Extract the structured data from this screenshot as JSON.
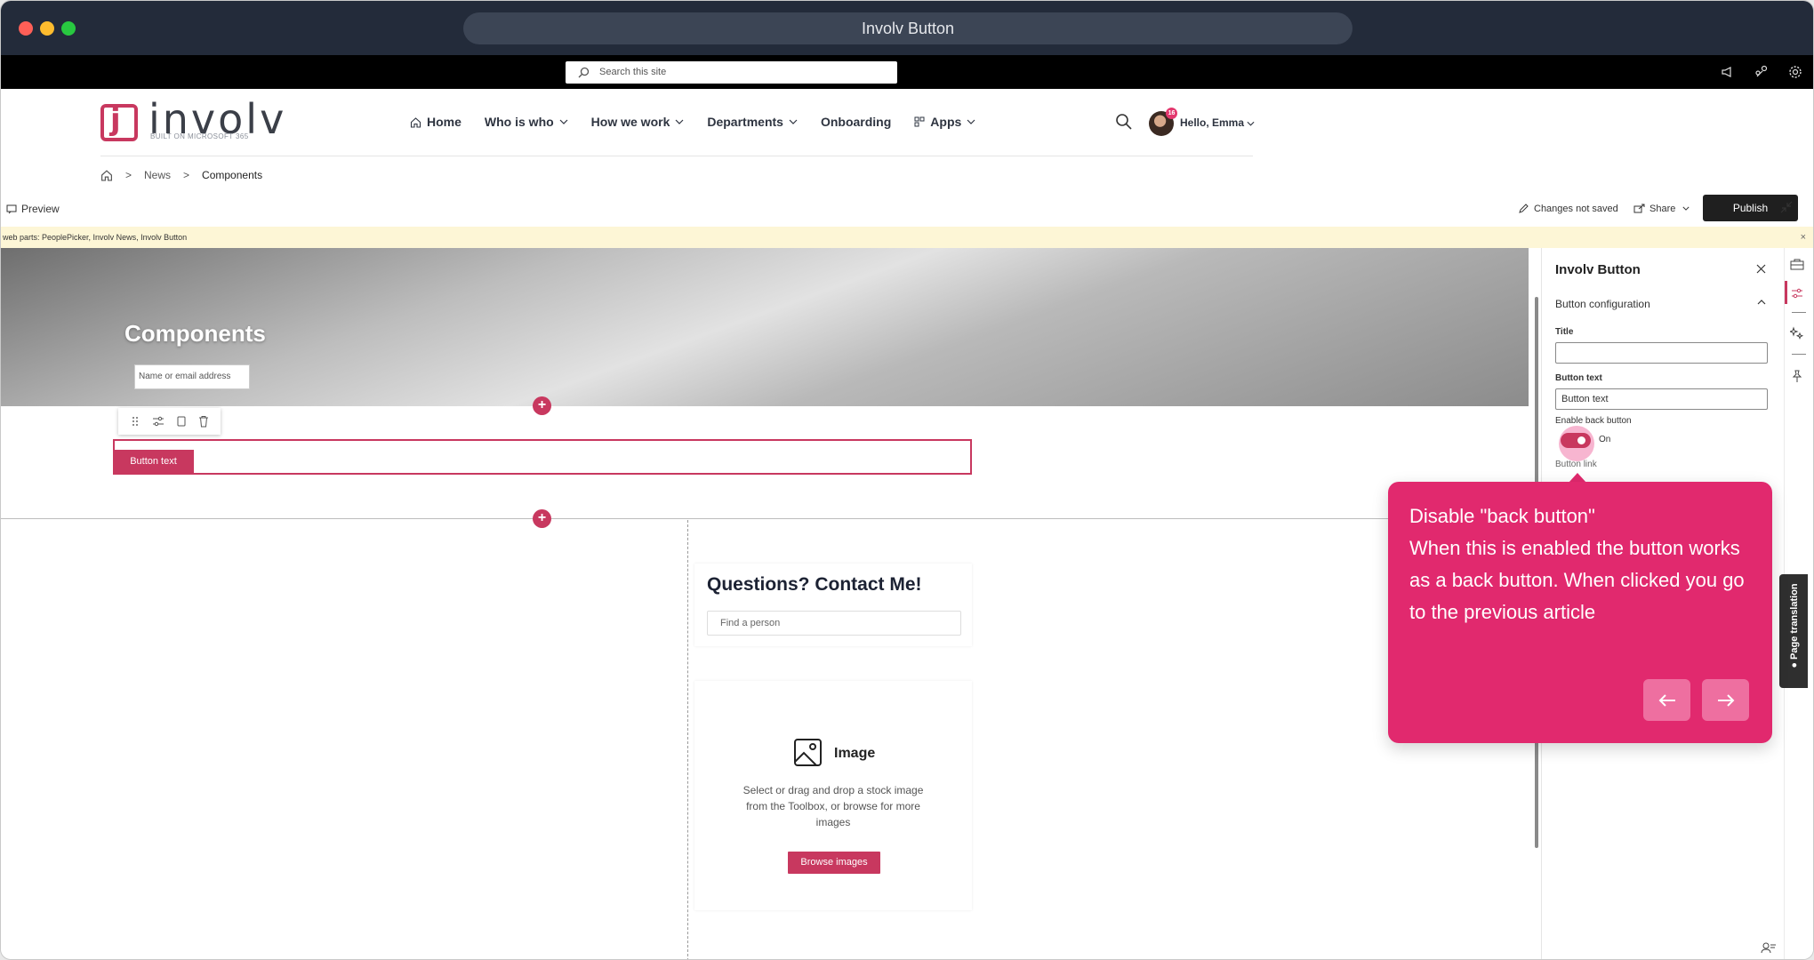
{
  "window": {
    "title": "Involv Button"
  },
  "suitebar": {
    "search_placeholder": "Search this site"
  },
  "brand": {
    "name": "involv",
    "tagline": "BUILT ON MICROSOFT 365",
    "accent": "#c8385f"
  },
  "nav": {
    "items": [
      {
        "label": "Home"
      },
      {
        "label": "Who is who"
      },
      {
        "label": "How we work"
      },
      {
        "label": "Departments"
      },
      {
        "label": "Onboarding"
      },
      {
        "label": "Apps"
      }
    ]
  },
  "user": {
    "greeting": "Hello, Emma",
    "badge": "16"
  },
  "breadcrumb": {
    "sep": ">",
    "items": [
      "News",
      "Components"
    ]
  },
  "editbar": {
    "preview": "Preview",
    "status": "Changes not saved",
    "share": "Share",
    "publish": "Publish"
  },
  "warning": {
    "text": "web parts: PeoplePicker, Involv News, Involv Button",
    "close": "×"
  },
  "hero": {
    "title": "Components",
    "people_placeholder": "Name or email address"
  },
  "button_webpart": {
    "label": "Button text"
  },
  "contact": {
    "title": "Questions? Contact Me!",
    "placeholder": "Find a person"
  },
  "image_webpart": {
    "title": "Image",
    "description": "Select or drag and drop a stock image from the Toolbox, or browse for more images",
    "browse": "Browse images"
  },
  "pane": {
    "title": "Involv Button",
    "section": "Button configuration",
    "title_label": "Title",
    "title_value": "",
    "button_text_label": "Button text",
    "button_text_value": "Button text",
    "enable_back_label": "Enable back button",
    "toggle_state": "On",
    "button_link_label": "Button link"
  },
  "page_translation": {
    "label": "Page translation"
  },
  "tooltip": {
    "text": "Disable \"back button\"\nWhen this is enabled the button works as a back button. When clicked you go to the previous article",
    "line1": "Disable \"back button\"",
    "line2": "When this is enabled the button works as a back button. When clicked you go to the previous article",
    "color": "#e1296e"
  }
}
